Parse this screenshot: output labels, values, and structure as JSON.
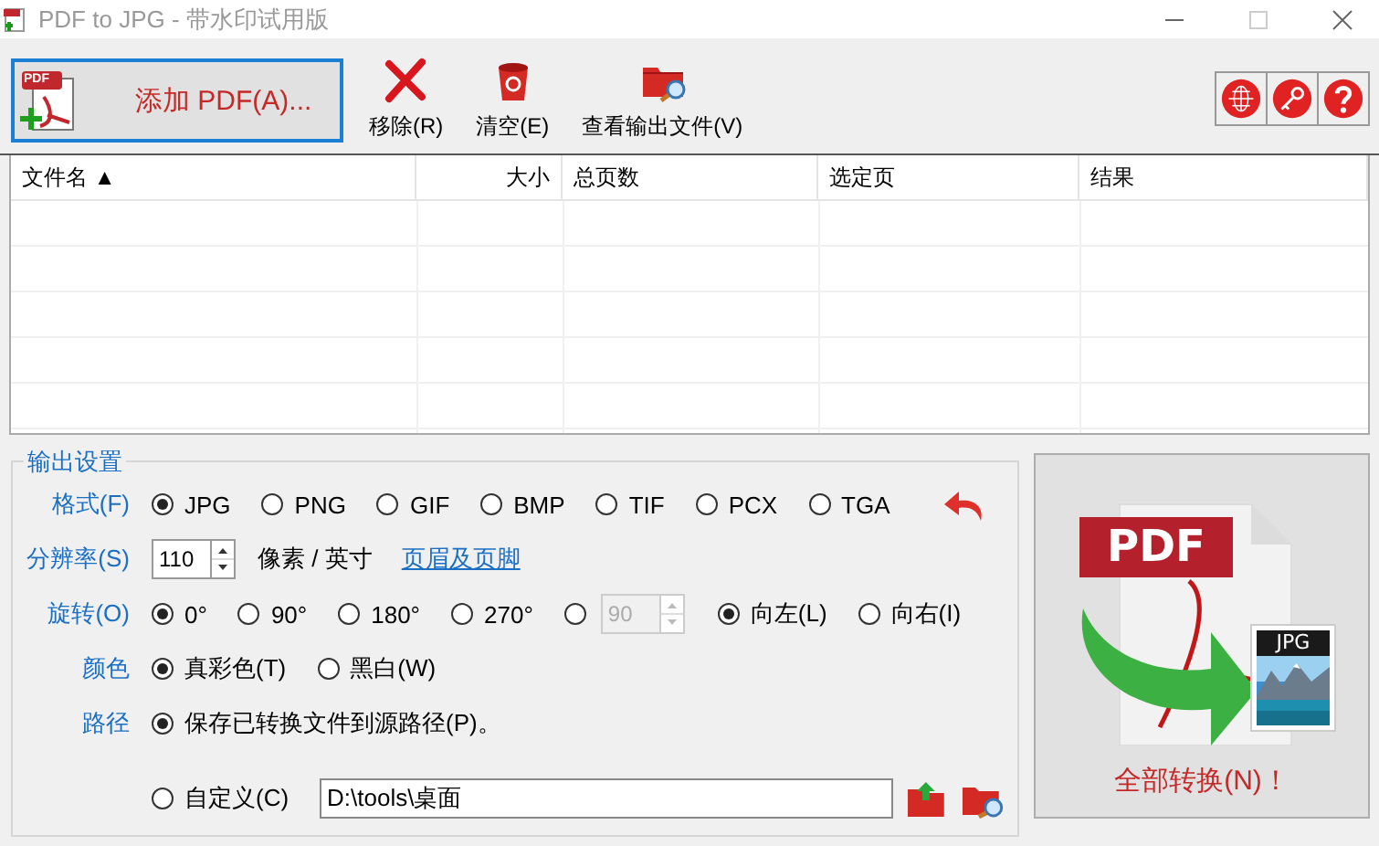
{
  "window": {
    "title": "PDF to JPG - 带水印试用版"
  },
  "toolbar": {
    "add_button": {
      "label": "添加 PDF(A)...",
      "icon_text": "PDF"
    },
    "buttons": [
      {
        "kind": "remove",
        "label": "移除(R)"
      },
      {
        "kind": "clear",
        "label": "清空(E)"
      },
      {
        "kind": "view",
        "label": "查看输出文件(V)"
      }
    ]
  },
  "table": {
    "columns": [
      {
        "label": "文件名 ▲"
      },
      {
        "label": "大小"
      },
      {
        "label": "总页数"
      },
      {
        "label": "选定页"
      },
      {
        "label": "结果"
      }
    ]
  },
  "settings": {
    "legend": "输出设置",
    "format": {
      "label": "格式(F)",
      "options": [
        {
          "label": "JPG",
          "selected": true
        },
        {
          "label": "PNG",
          "selected": false
        },
        {
          "label": "GIF",
          "selected": false
        },
        {
          "label": "BMP",
          "selected": false
        },
        {
          "label": "TIF",
          "selected": false
        },
        {
          "label": "PCX",
          "selected": false
        },
        {
          "label": "TGA",
          "selected": false
        }
      ]
    },
    "resolution": {
      "label": "分辨率(S)",
      "value": "110",
      "unit": "像素 / 英寸",
      "link": "页眉及页脚"
    },
    "rotation": {
      "label": "旋转(O)",
      "angles": [
        {
          "label": "0°",
          "selected": true
        },
        {
          "label": "90°",
          "selected": false
        },
        {
          "label": "180°",
          "selected": false
        },
        {
          "label": "270°",
          "selected": false
        }
      ],
      "custom": {
        "selected": false,
        "value": "90",
        "disabled": true
      },
      "directions": [
        {
          "label": "向左(L)",
          "selected": true
        },
        {
          "label": "向右(I)",
          "selected": false
        }
      ]
    },
    "color": {
      "label": "颜色",
      "options": [
        {
          "label": "真彩色(T)",
          "selected": true
        },
        {
          "label": "黑白(W)",
          "selected": false
        }
      ]
    },
    "path": {
      "label": "路径",
      "source": {
        "label": "保存已转换文件到源路径(P)。",
        "selected": true
      },
      "custom": {
        "label": "自定义(C)",
        "selected": false,
        "value": "D:\\tools\\桌面"
      }
    }
  },
  "convert": {
    "label": "全部转换(N)！",
    "pdf_text": "PDF",
    "jpg_text": "JPG"
  }
}
